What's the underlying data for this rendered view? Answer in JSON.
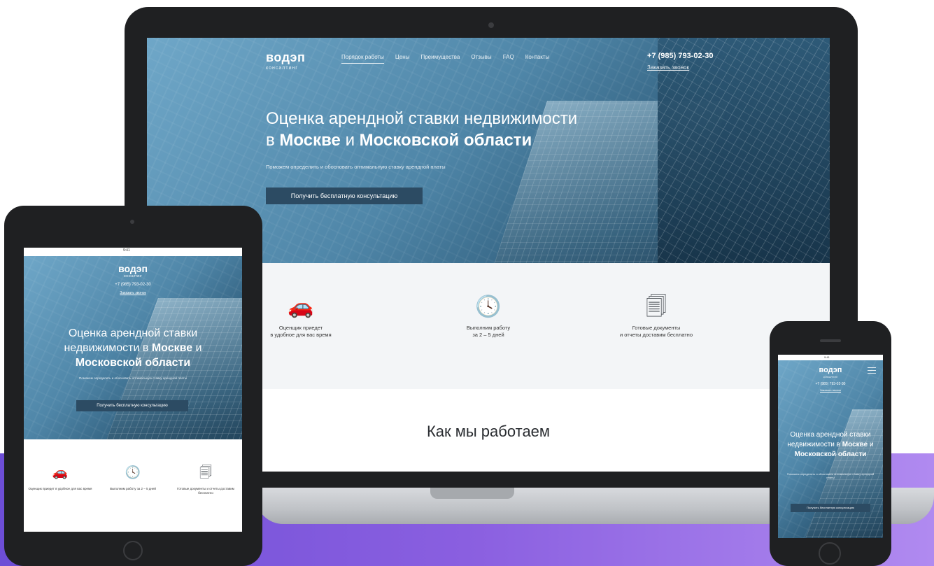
{
  "brand": {
    "logo": "водэп",
    "logo_sub": "консалтинг"
  },
  "nav": {
    "items": [
      "Порядок работы",
      "Цены",
      "Преимущества",
      "Отзывы",
      "FAQ",
      "Контакты"
    ],
    "phone": "+7 (985) 793-02-30",
    "callback": "Заказать звонок"
  },
  "hero": {
    "title_line1": "Оценка арендной ставки недвижимости",
    "title_prefix": "в ",
    "title_city": "Москве",
    "title_and": " и ",
    "title_region": "Московской области",
    "subtitle": "Поможем определить и обосновать оптимальную ставку арендной платы",
    "cta": "Получить бесплатную консультацию"
  },
  "features": [
    {
      "icon": "car-icon",
      "glyph": "🚗",
      "line1": "Оценщик приедет",
      "line2": "в удобное для вас время"
    },
    {
      "icon": "history-clock-icon",
      "glyph": "🕓",
      "line1": "Выполним работу",
      "line2": "за 2 – 5 дней"
    },
    {
      "icon": "documents-icon",
      "glyph": "🗐",
      "line1": "Готовые документы",
      "line2": "и отчеты доставим бесплатно"
    }
  ],
  "section_title": "Как мы работаем",
  "tablet": {
    "title_line": "Оценка арендной ставки недвижимости в ",
    "features": [
      "Оценщик приедет в удобное для вас время",
      "Выполним работу за 2 – 5 дней",
      "Готовые документы и отчеты доставим бесплатно"
    ],
    "status_time": "9:41"
  },
  "phone_device": {
    "status_time": "9:41"
  },
  "colors": {
    "button_bg": "#2c4b63",
    "hero_blue": "#4f86a8",
    "features_bg": "#f3f5f7",
    "device_frame": "#1f2022",
    "purple_band": "#8a5fe0"
  }
}
